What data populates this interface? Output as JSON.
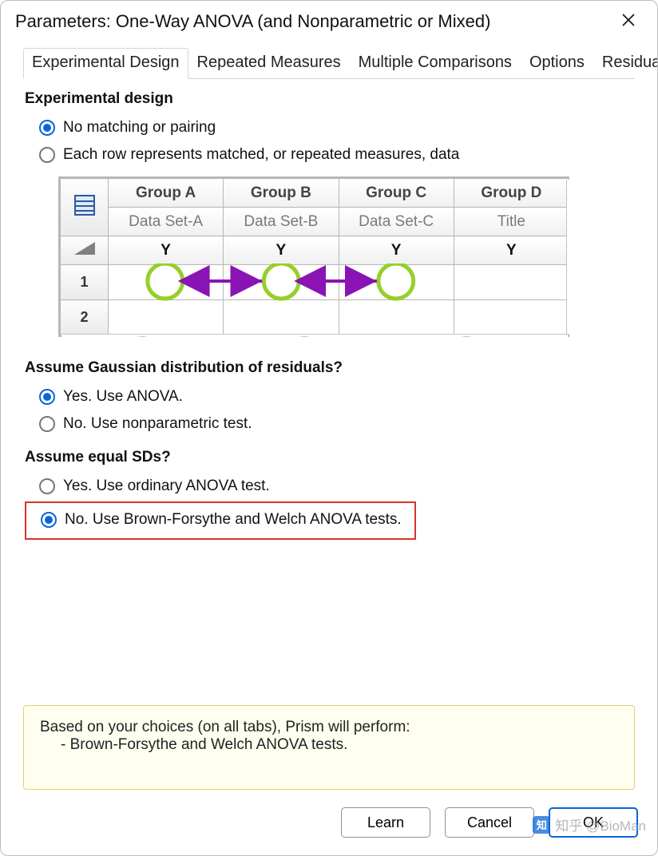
{
  "window": {
    "title": "Parameters: One-Way ANOVA (and Nonparametric or Mixed)"
  },
  "tabs": [
    {
      "label": "Experimental Design",
      "active": true
    },
    {
      "label": "Repeated Measures",
      "active": false
    },
    {
      "label": "Multiple Comparisons",
      "active": false
    },
    {
      "label": "Options",
      "active": false
    },
    {
      "label": "Residuals",
      "active": false
    }
  ],
  "sections": {
    "design": {
      "heading": "Experimental design",
      "opts": [
        {
          "label": "No matching or pairing",
          "selected": true
        },
        {
          "label": "Each row represents matched, or repeated measures, data",
          "selected": false
        }
      ]
    },
    "gaussian": {
      "heading": "Assume Gaussian distribution of residuals?",
      "opts": [
        {
          "label": "Yes. Use ANOVA.",
          "selected": true
        },
        {
          "label": "No. Use nonparametric test.",
          "selected": false
        }
      ]
    },
    "equalsd": {
      "heading": "Assume equal SDs?",
      "opts": [
        {
          "label": "Yes. Use ordinary ANOVA test.",
          "selected": false
        },
        {
          "label": "No. Use Brown-Forsythe and Welch ANOVA tests.",
          "selected": true,
          "highlight": true
        }
      ]
    }
  },
  "diagram": {
    "groups": [
      "Group A",
      "Group B",
      "Group C",
      "Group D"
    ],
    "datasets": [
      "Data Set-A",
      "Data Set-B",
      "Data Set-C",
      "Title"
    ],
    "measure": "Y",
    "rows": [
      "1",
      "2"
    ]
  },
  "summary": {
    "lead": "Based on your choices (on all tabs), Prism will perform:",
    "item": "- Brown-Forsythe and Welch ANOVA tests."
  },
  "buttons": {
    "learn": "Learn",
    "cancel": "Cancel",
    "ok": "OK"
  },
  "watermark": "知乎 @BioMan"
}
